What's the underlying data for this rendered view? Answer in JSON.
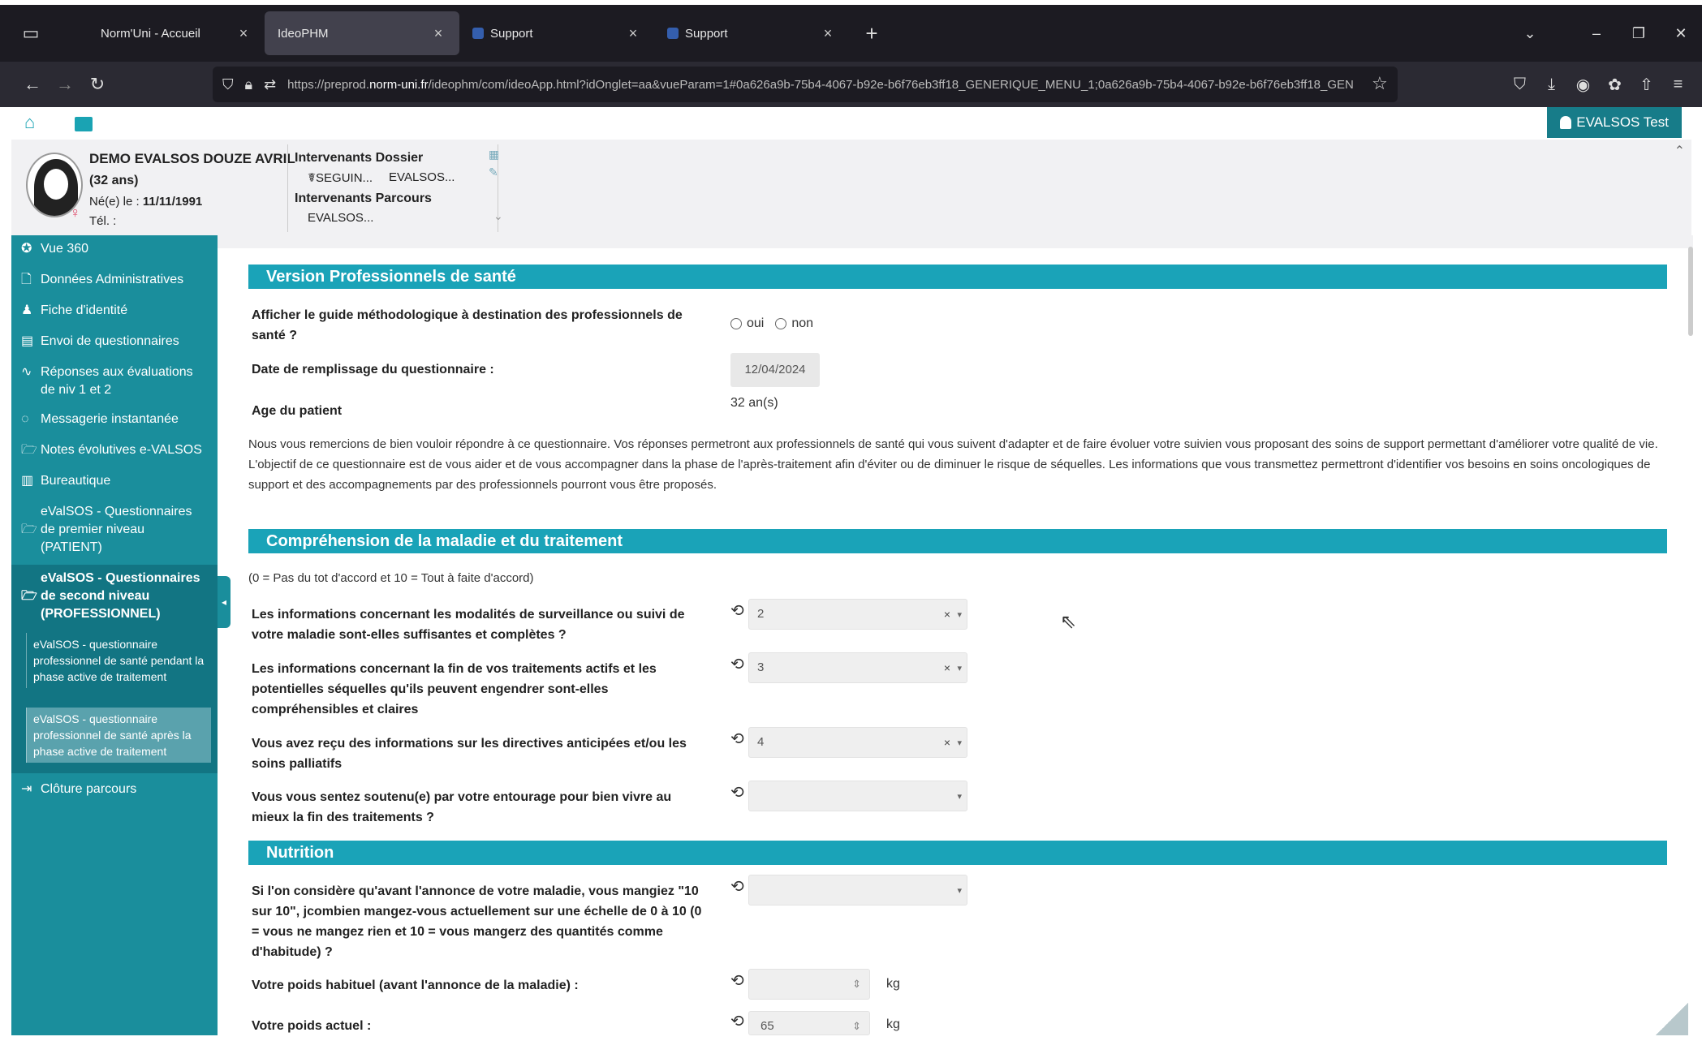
{
  "browser": {
    "tabs": [
      {
        "label": "Norm'Uni - Accueil",
        "active": false
      },
      {
        "label": "IdeoPHM",
        "active": true
      },
      {
        "label": "Support",
        "active": false
      },
      {
        "label": "Support",
        "active": false
      }
    ],
    "url_pre": "https://preprod.",
    "url_domain": "norm-uni.fr",
    "url_post": "/ideophm/com/ideoApp.html?idOnglet=aa&vueParam=1#0a626a9b-75b4-4067-b92e-b6f76eb3ff18_GENERIQUE_MENU_1;0a626a9b-75b4-4067-b92e-b6f76eb3ff18_GEN"
  },
  "header": {
    "user_label": "EVALSOS Test"
  },
  "patient": {
    "name": "DEMO EVALSOS DOUZE AVRIL",
    "age": "(32 ans)",
    "dob_label": "Né(e) le : ",
    "dob_value": "11/11/1991",
    "tel_label": "Tél. :",
    "intervenants_dossier_label": "Intervenants Dossier",
    "intervenants_dossier": [
      "☤SEGUIN...",
      "EVALSOS..."
    ],
    "intervenants_parcours_label": "Intervenants Parcours",
    "intervenants_parcours": [
      "EVALSOS..."
    ]
  },
  "sidebar": {
    "items": [
      {
        "label": "Vue 360",
        "icon": "vue360-icon"
      },
      {
        "label": "Données Administratives",
        "icon": "document-icon"
      },
      {
        "label": "Fiche d'identité",
        "icon": "user-icon"
      },
      {
        "label": "Envoi de questionnaires",
        "icon": "clipboard-icon"
      },
      {
        "label": "Réponses aux évaluations de niv 1 et 2",
        "icon": "pulse-icon"
      },
      {
        "label": "Messagerie instantanée",
        "icon": "chat-icon"
      },
      {
        "label": "Notes évolutives e-VALSOS",
        "icon": "folder-open-icon"
      },
      {
        "label": "Bureautique",
        "icon": "file-icon"
      },
      {
        "label": "eValSOS - Questionnaires de premier niveau (PATIENT)",
        "icon": "folder-open-icon"
      },
      {
        "label": "eValSOS - Questionnaires de second niveau (PROFESSIONNEL)",
        "icon": "folder-open-icon"
      },
      {
        "label": "Clôture parcours",
        "icon": "exit-icon"
      }
    ],
    "subitems": [
      {
        "label": "eValSOS - questionnaire professionnel de santé pendant la phase active de traitement",
        "active": false
      },
      {
        "label": "eValSOS - questionnaire professionnel de santé après la phase active de traitement",
        "active": true
      }
    ]
  },
  "form": {
    "sections": {
      "version": "Version Professionnels de santé",
      "comprehension": "Compréhension de la maladie et du traitement",
      "nutrition": "Nutrition"
    },
    "guide_question": "Afficher le guide méthodologique à destination des professionnels de santé ?",
    "radio_oui": "oui",
    "radio_non": "non",
    "date_label": "Date de remplissage du questionnaire :",
    "date_value": "12/04/2024",
    "age_label": "Age du patient",
    "age_value": "32 an(s)",
    "intro": "Nous vous remercions de bien vouloir répondre à ce questionnaire. Vos réponses permetront aux professionnels de santé qui vous suivent d'adapter et de faire évoluer votre suivien vous proposant des soins de support permettant d'améliorer votre qualité de vie. L'objectif de ce questionnaire est de vous aider et de vous accompagner dans la phase de l'après-traitement afin d'éviter ou de diminuer le risque de séquelles. Les informations que vous transmettez permettront d'identifier vos besoins en soins oncologiques de support et des accompagnements par des professionnels pourront vous être proposés.",
    "scale_note": "(0 = Pas du tot d'accord et 10 = Tout à faite d'accord)",
    "questions": [
      {
        "label": "Les informations concernant les modalités de surveillance ou suivi de votre maladie sont-elles suffisantes et complètes ?",
        "value": "2"
      },
      {
        "label": "Les informations concernant la fin de vos traitements actifs et les potentielles séquelles qu'ils peuvent engendrer sont-elles compréhensibles et claires",
        "value": "3"
      },
      {
        "label": "Vous avez reçu des informations sur les directives anticipées et/ou les soins palliatifs",
        "value": "4"
      },
      {
        "label": "Vous vous sentez soutenu(e) par votre entourage pour bien vivre au mieux la fin des traitements ?",
        "value": ""
      }
    ],
    "nutrition_q1": "Si l'on considère qu'avant l'annonce de votre maladie, vous mangiez \"10 sur 10\", jcombien mangez-vous actuellement sur une échelle de 0 à 10 (0 = vous ne mangez rien et 10 = vous mangerz des quantités comme d'habitude) ?",
    "poids_habituel_label": "Votre poids habituel (avant l'annonce de la maladie) :",
    "poids_habituel_value": "",
    "poids_actuel_label": "Votre poids actuel :",
    "poids_actuel_value": "65",
    "unit_kg": "kg"
  }
}
